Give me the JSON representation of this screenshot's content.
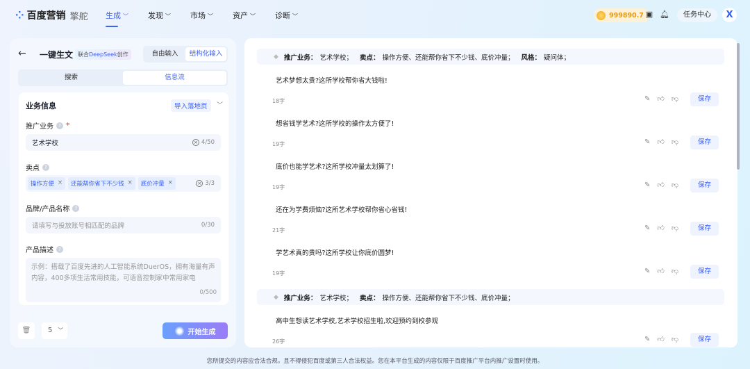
{
  "header": {
    "logo": "百度营销",
    "logo_sub": "擎舵",
    "nav": [
      "生成",
      "发现",
      "市场",
      "资产",
      "诊断"
    ],
    "active_nav": 0,
    "balance": "999890.7",
    "task_center": "任务中心",
    "avatar": "X"
  },
  "left": {
    "title": "一键生文",
    "badge_prefix": "联合",
    "badge_brand": "DeepSeek",
    "badge_suffix": "创作",
    "input_modes": [
      "自由输入",
      "结构化输入"
    ],
    "active_mode": 1,
    "channels": [
      "搜索",
      "信息流"
    ],
    "active_channel": 1,
    "section_title": "业务信息",
    "import_button": "导入落地页",
    "business_label": "推广业务",
    "business_value": "艺术学校",
    "business_count": "4/50",
    "selling_label": "卖点",
    "selling_tags": [
      "操作方便",
      "还能帮你省下不少钱",
      "底价冲量"
    ],
    "selling_count": "3/3",
    "brand_label": "品牌/产品名称",
    "brand_placeholder": "请填写与投放账号相匹配的品牌",
    "brand_count": "0/30",
    "desc_label": "产品描述",
    "desc_placeholder": "示例：搭载了百度先进的人工智能系统DuerOS，拥有海量有声内容，400多项生活常用技能，可语音控制家中常用家电",
    "desc_count": "0/500",
    "quantity": "5",
    "generate_button": "开始生成"
  },
  "results": {
    "save_label": "保存",
    "groups": [
      {
        "business_key": "推广业务：",
        "business": "艺术学校；",
        "selling_key": "卖点：",
        "selling": "操作方便、还能帮你省下不少钱、底价冲量；",
        "style_key": "风格：",
        "style": "疑问体；",
        "items": [
          {
            "text": "艺术梦想太贵?这所学校帮你省大钱啦!",
            "count": "18字"
          },
          {
            "text": "想省钱学艺术?这所学校的操作太方便了!",
            "count": "19字"
          },
          {
            "text": "底价也能学艺术?这所学校冲量太划算了!",
            "count": "19字"
          },
          {
            "text": "还在为学费烦恼?这所艺术学校帮你省心省钱!",
            "count": "21字"
          },
          {
            "text": "学艺术真的贵吗?这所学校让你底价圆梦!",
            "count": "19字"
          }
        ]
      },
      {
        "business_key": "推广业务：",
        "business": "艺术学校；",
        "selling_key": "卖点：",
        "selling": "操作方便、还能帮你省下不少钱、底价冲量；",
        "items": [
          {
            "text": "高中生想读艺术学校,艺术学校招生啦,欢迎预约到校参观",
            "count": "26字"
          }
        ]
      }
    ]
  },
  "footer": "您所提交的内容应合法合规，且不得侵犯百度或第三人合法权益。您在本平台生成的内容仅限于百度推广平台内推广设置时使用。",
  "colors": {
    "accent": "#3f62f6",
    "balance": "#e29a14"
  }
}
